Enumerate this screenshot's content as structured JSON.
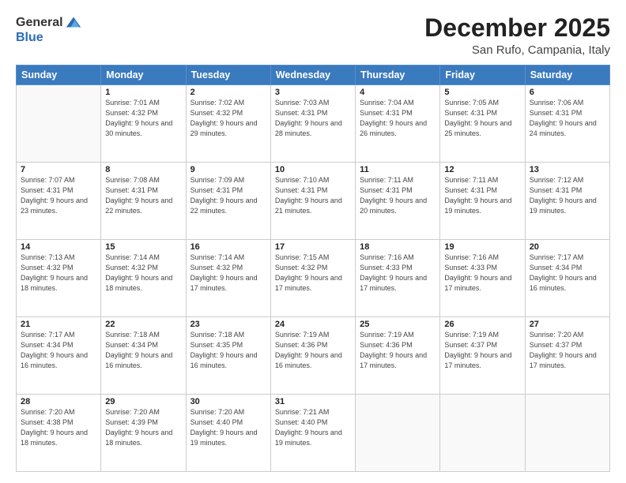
{
  "header": {
    "logo_general": "General",
    "logo_blue": "Blue",
    "month": "December 2025",
    "location": "San Rufo, Campania, Italy"
  },
  "weekdays": [
    "Sunday",
    "Monday",
    "Tuesday",
    "Wednesday",
    "Thursday",
    "Friday",
    "Saturday"
  ],
  "weeks": [
    [
      {
        "day": "",
        "sunrise": "",
        "sunset": "",
        "daylight": ""
      },
      {
        "day": "1",
        "sunrise": "Sunrise: 7:01 AM",
        "sunset": "Sunset: 4:32 PM",
        "daylight": "Daylight: 9 hours and 30 minutes."
      },
      {
        "day": "2",
        "sunrise": "Sunrise: 7:02 AM",
        "sunset": "Sunset: 4:32 PM",
        "daylight": "Daylight: 9 hours and 29 minutes."
      },
      {
        "day": "3",
        "sunrise": "Sunrise: 7:03 AM",
        "sunset": "Sunset: 4:31 PM",
        "daylight": "Daylight: 9 hours and 28 minutes."
      },
      {
        "day": "4",
        "sunrise": "Sunrise: 7:04 AM",
        "sunset": "Sunset: 4:31 PM",
        "daylight": "Daylight: 9 hours and 26 minutes."
      },
      {
        "day": "5",
        "sunrise": "Sunrise: 7:05 AM",
        "sunset": "Sunset: 4:31 PM",
        "daylight": "Daylight: 9 hours and 25 minutes."
      },
      {
        "day": "6",
        "sunrise": "Sunrise: 7:06 AM",
        "sunset": "Sunset: 4:31 PM",
        "daylight": "Daylight: 9 hours and 24 minutes."
      }
    ],
    [
      {
        "day": "7",
        "sunrise": "Sunrise: 7:07 AM",
        "sunset": "Sunset: 4:31 PM",
        "daylight": "Daylight: 9 hours and 23 minutes."
      },
      {
        "day": "8",
        "sunrise": "Sunrise: 7:08 AM",
        "sunset": "Sunset: 4:31 PM",
        "daylight": "Daylight: 9 hours and 22 minutes."
      },
      {
        "day": "9",
        "sunrise": "Sunrise: 7:09 AM",
        "sunset": "Sunset: 4:31 PM",
        "daylight": "Daylight: 9 hours and 22 minutes."
      },
      {
        "day": "10",
        "sunrise": "Sunrise: 7:10 AM",
        "sunset": "Sunset: 4:31 PM",
        "daylight": "Daylight: 9 hours and 21 minutes."
      },
      {
        "day": "11",
        "sunrise": "Sunrise: 7:11 AM",
        "sunset": "Sunset: 4:31 PM",
        "daylight": "Daylight: 9 hours and 20 minutes."
      },
      {
        "day": "12",
        "sunrise": "Sunrise: 7:11 AM",
        "sunset": "Sunset: 4:31 PM",
        "daylight": "Daylight: 9 hours and 19 minutes."
      },
      {
        "day": "13",
        "sunrise": "Sunrise: 7:12 AM",
        "sunset": "Sunset: 4:31 PM",
        "daylight": "Daylight: 9 hours and 19 minutes."
      }
    ],
    [
      {
        "day": "14",
        "sunrise": "Sunrise: 7:13 AM",
        "sunset": "Sunset: 4:32 PM",
        "daylight": "Daylight: 9 hours and 18 minutes."
      },
      {
        "day": "15",
        "sunrise": "Sunrise: 7:14 AM",
        "sunset": "Sunset: 4:32 PM",
        "daylight": "Daylight: 9 hours and 18 minutes."
      },
      {
        "day": "16",
        "sunrise": "Sunrise: 7:14 AM",
        "sunset": "Sunset: 4:32 PM",
        "daylight": "Daylight: 9 hours and 17 minutes."
      },
      {
        "day": "17",
        "sunrise": "Sunrise: 7:15 AM",
        "sunset": "Sunset: 4:32 PM",
        "daylight": "Daylight: 9 hours and 17 minutes."
      },
      {
        "day": "18",
        "sunrise": "Sunrise: 7:16 AM",
        "sunset": "Sunset: 4:33 PM",
        "daylight": "Daylight: 9 hours and 17 minutes."
      },
      {
        "day": "19",
        "sunrise": "Sunrise: 7:16 AM",
        "sunset": "Sunset: 4:33 PM",
        "daylight": "Daylight: 9 hours and 17 minutes."
      },
      {
        "day": "20",
        "sunrise": "Sunrise: 7:17 AM",
        "sunset": "Sunset: 4:34 PM",
        "daylight": "Daylight: 9 hours and 16 minutes."
      }
    ],
    [
      {
        "day": "21",
        "sunrise": "Sunrise: 7:17 AM",
        "sunset": "Sunset: 4:34 PM",
        "daylight": "Daylight: 9 hours and 16 minutes."
      },
      {
        "day": "22",
        "sunrise": "Sunrise: 7:18 AM",
        "sunset": "Sunset: 4:34 PM",
        "daylight": "Daylight: 9 hours and 16 minutes."
      },
      {
        "day": "23",
        "sunrise": "Sunrise: 7:18 AM",
        "sunset": "Sunset: 4:35 PM",
        "daylight": "Daylight: 9 hours and 16 minutes."
      },
      {
        "day": "24",
        "sunrise": "Sunrise: 7:19 AM",
        "sunset": "Sunset: 4:36 PM",
        "daylight": "Daylight: 9 hours and 16 minutes."
      },
      {
        "day": "25",
        "sunrise": "Sunrise: 7:19 AM",
        "sunset": "Sunset: 4:36 PM",
        "daylight": "Daylight: 9 hours and 17 minutes."
      },
      {
        "day": "26",
        "sunrise": "Sunrise: 7:19 AM",
        "sunset": "Sunset: 4:37 PM",
        "daylight": "Daylight: 9 hours and 17 minutes."
      },
      {
        "day": "27",
        "sunrise": "Sunrise: 7:20 AM",
        "sunset": "Sunset: 4:37 PM",
        "daylight": "Daylight: 9 hours and 17 minutes."
      }
    ],
    [
      {
        "day": "28",
        "sunrise": "Sunrise: 7:20 AM",
        "sunset": "Sunset: 4:38 PM",
        "daylight": "Daylight: 9 hours and 18 minutes."
      },
      {
        "day": "29",
        "sunrise": "Sunrise: 7:20 AM",
        "sunset": "Sunset: 4:39 PM",
        "daylight": "Daylight: 9 hours and 18 minutes."
      },
      {
        "day": "30",
        "sunrise": "Sunrise: 7:20 AM",
        "sunset": "Sunset: 4:40 PM",
        "daylight": "Daylight: 9 hours and 19 minutes."
      },
      {
        "day": "31",
        "sunrise": "Sunrise: 7:21 AM",
        "sunset": "Sunset: 4:40 PM",
        "daylight": "Daylight: 9 hours and 19 minutes."
      },
      {
        "day": "",
        "sunrise": "",
        "sunset": "",
        "daylight": ""
      },
      {
        "day": "",
        "sunrise": "",
        "sunset": "",
        "daylight": ""
      },
      {
        "day": "",
        "sunrise": "",
        "sunset": "",
        "daylight": ""
      }
    ]
  ]
}
